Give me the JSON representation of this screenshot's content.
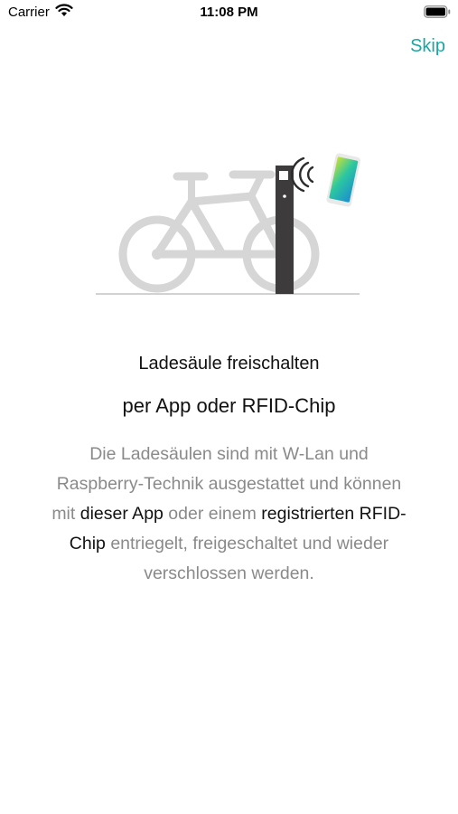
{
  "status_bar": {
    "carrier": "Carrier",
    "time": "11:08 PM",
    "wifi_icon": "wifi-icon",
    "battery_icon": "battery-icon"
  },
  "header": {
    "skip_label": "Skip",
    "accent_color": "#1aa7a1"
  },
  "illustration": {
    "icons": [
      "bicycle-icon",
      "charging-pole-icon",
      "nfc-signal-icon",
      "smartphone-icon"
    ]
  },
  "content": {
    "title": "Ladesäule freischalten",
    "subtitle": "per App oder RFID-Chip",
    "body": {
      "part1": "Die Ladesäulen sind mit W-Lan und Raspberry-Technik ausgestattet und können mit ",
      "bold1": "dieser App",
      "part2": " oder einem ",
      "bold2": "registrierten RFID-Chip",
      "part3": " entriegelt, freigeschaltet und wieder verschlossen werden."
    }
  }
}
